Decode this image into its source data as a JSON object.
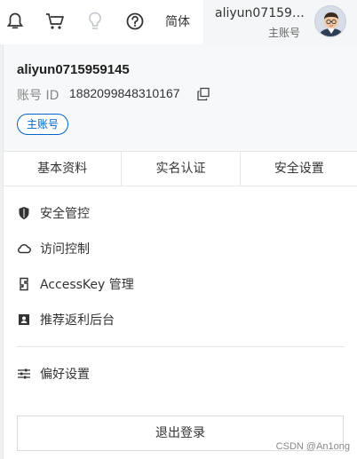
{
  "topbar": {
    "icons": [
      "bell-icon",
      "cart-icon",
      "lightbulb-icon",
      "help-icon"
    ],
    "language_label": "简体",
    "account": {
      "name": "aliyun07159…",
      "type_label": "主账号"
    }
  },
  "panel": {
    "user_id": "aliyun0715959145",
    "account_id_label": "账号 ID",
    "account_id_value": "1882099848310167",
    "badge_label": "主账号",
    "tabs": [
      {
        "label": "基本资料"
      },
      {
        "label": "实名认证"
      },
      {
        "label": "安全设置"
      }
    ],
    "menu_items": [
      {
        "label": "安全管控",
        "icon": "shield-icon"
      },
      {
        "label": "访问控制",
        "icon": "cloud-icon"
      },
      {
        "label": "AccessKey 管理",
        "icon": "key-icon"
      },
      {
        "label": "推荐返利后台",
        "icon": "user-card-icon"
      }
    ],
    "preferences_label": "偏好设置",
    "logout_label": "退出登录"
  },
  "watermark": "CSDN @An1ong",
  "colors": {
    "accent": "#0064c8",
    "header_bg": "#f7f8fa",
    "account_box_bg": "#f5f6f7",
    "divider": "#e5e6e8"
  }
}
